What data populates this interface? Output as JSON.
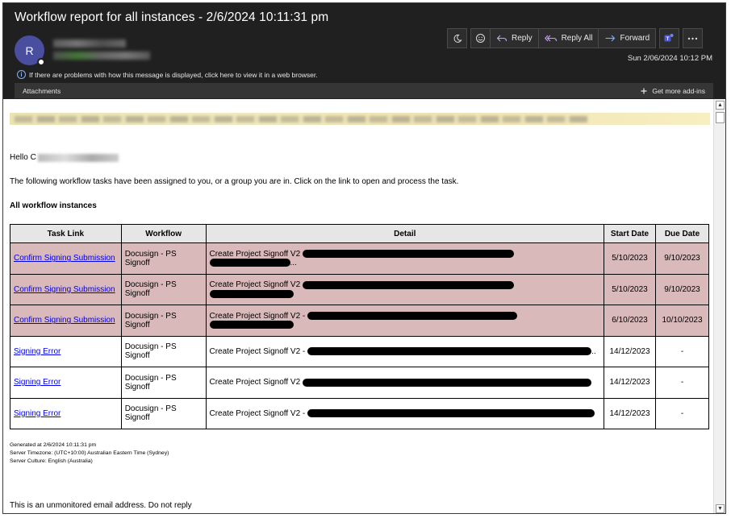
{
  "header": {
    "subject": "Workflow report for all instances - 2/6/2024 10:11:31 pm",
    "avatar_initial": "R",
    "date": "Sun 2/06/2024 10:12 PM",
    "info_text": "If there are problems with how this message is displayed, click here to view it in a web browser.",
    "attachments_label": "Attachments",
    "addins_label": "Get more add-ins"
  },
  "toolbar": {
    "reply_label": "Reply",
    "reply_all_label": "Reply All",
    "forward_label": "Forward"
  },
  "body": {
    "hello": "Hello C",
    "intro": "The following workflow tasks have been assigned to you, or a group you are in. Click on the link to open and process the task.",
    "section_title": "All workflow instances",
    "table": {
      "headers": [
        "Task Link",
        "Workflow",
        "Detail",
        "Start Date",
        "Due Date"
      ],
      "rows": [
        {
          "task": "Confirm Signing Submission",
          "workflow": "Docusign - PS Signoff",
          "detail": "Create Project Signoff V2",
          "detail_tail": "...",
          "start": "5/10/2023",
          "due": "9/10/2023"
        },
        {
          "task": "Confirm Signing Submission",
          "workflow": "Docusign - PS Signoff",
          "detail": "Create Project Signoff V2",
          "detail_tail": "",
          "start": "5/10/2023",
          "due": "9/10/2023"
        },
        {
          "task": "Confirm Signing Submission",
          "workflow": "Docusign - PS Signoff",
          "detail": "Create Project Signoff V2 -",
          "detail_tail": "",
          "start": "6/10/2023",
          "due": "10/10/2023"
        },
        {
          "task": "Signing Error",
          "workflow": "Docusign - PS Signoff",
          "detail": "Create Project Signoff V2 -",
          "detail_tail": "..",
          "start": "14/12/2023",
          "due": "-"
        },
        {
          "task": "Signing Error",
          "workflow": "Docusign - PS Signoff",
          "detail": "Create Project Signoff V2",
          "detail_tail": "",
          "start": "14/12/2023",
          "due": "-"
        },
        {
          "task": "Signing Error",
          "workflow": "Docusign - PS Signoff",
          "detail": "Create Project Signoff V2 -",
          "detail_tail": "",
          "start": "14/12/2023",
          "due": "-"
        }
      ]
    },
    "footer": {
      "generated": "Generated at 2/6/2024 10:11:31 pm",
      "timezone": "Server Timezone: (UTC+10:00) Australian Eastern Time (Sydney)",
      "culture": "Server Culture: English (Australia)"
    },
    "unmonitored": "This is an unmonitored email address. Do not reply"
  },
  "colors": {
    "header_bg": "#202020",
    "highlight_row": "#d9b9b9",
    "link": "#0000ee",
    "avatar": "#4a4e9e"
  }
}
